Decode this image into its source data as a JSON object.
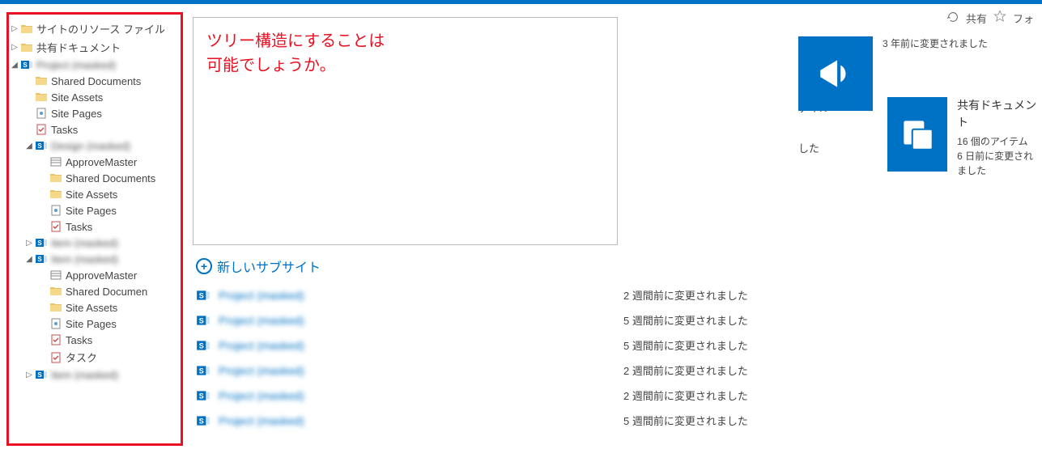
{
  "header": {
    "share_label": "共有",
    "follow_label": "フォ"
  },
  "annotation": {
    "line1": "ツリー構造にすることは",
    "line2": "可能でしょうか。"
  },
  "sidebar": {
    "items": [
      {
        "label": "サイトのリソース ファイル",
        "icon": "folder-icon",
        "expander": "▷",
        "indent": 0
      },
      {
        "label": "共有ドキュメント",
        "icon": "folder-icon",
        "expander": "▷",
        "indent": 0
      },
      {
        "label": "Project (masked)",
        "icon": "sharepoint-icon",
        "expander": "◢",
        "indent": 0,
        "masked": true
      },
      {
        "label": "Shared Documents",
        "icon": "folder-icon",
        "expander": "",
        "indent": 1
      },
      {
        "label": "Site Assets",
        "icon": "folder-icon",
        "expander": "",
        "indent": 1
      },
      {
        "label": "Site Pages",
        "icon": "page-icon",
        "expander": "",
        "indent": 1
      },
      {
        "label": "Tasks",
        "icon": "task-icon",
        "expander": "",
        "indent": 1
      },
      {
        "label": "Design (masked)",
        "icon": "sharepoint-icon",
        "expander": "◢",
        "indent": 1,
        "masked": true
      },
      {
        "label": "ApproveMaster",
        "icon": "list-icon",
        "expander": "",
        "indent": 2
      },
      {
        "label": "Shared Documents",
        "icon": "folder-icon",
        "expander": "",
        "indent": 2
      },
      {
        "label": "Site Assets",
        "icon": "folder-icon",
        "expander": "",
        "indent": 2
      },
      {
        "label": "Site Pages",
        "icon": "page-icon",
        "expander": "",
        "indent": 2
      },
      {
        "label": "Tasks",
        "icon": "task-icon",
        "expander": "",
        "indent": 2
      },
      {
        "label": "Item (masked)",
        "icon": "sharepoint-icon",
        "expander": "▷",
        "indent": 1,
        "masked": true
      },
      {
        "label": "Item (masked)",
        "icon": "sharepoint-icon",
        "expander": "◢",
        "indent": 1,
        "masked": true
      },
      {
        "label": "ApproveMaster",
        "icon": "list-icon",
        "expander": "",
        "indent": 2
      },
      {
        "label": "Shared Documen",
        "icon": "folder-icon",
        "expander": "",
        "indent": 2
      },
      {
        "label": "Site Assets",
        "icon": "folder-icon",
        "expander": "",
        "indent": 2
      },
      {
        "label": "Site Pages",
        "icon": "page-icon",
        "expander": "",
        "indent": 2
      },
      {
        "label": "Tasks",
        "icon": "task-icon",
        "expander": "",
        "indent": 2
      },
      {
        "label": "タスク",
        "icon": "task-icon",
        "expander": "",
        "indent": 2
      },
      {
        "label": "Item (masked)",
        "icon": "sharepoint-icon",
        "expander": "▷",
        "indent": 1,
        "masked": true
      }
    ]
  },
  "partial": {
    "p1": "ました",
    "p2": "ァイル",
    "p3": "した"
  },
  "tiles": {
    "t1_meta": "3 年前に変更されました",
    "t2_title": "共有ドキュメント",
    "t2_meta1": "16 個のアイテム",
    "t2_meta2": "6 日前に変更されました"
  },
  "new_subsite_label": "新しいサブサイト",
  "subsites": [
    {
      "name": "Project (masked)",
      "date": "2 週間前に変更されました"
    },
    {
      "name": "Project (masked)",
      "date": "5 週間前に変更されました"
    },
    {
      "name": "Project (masked)",
      "date": "5 週間前に変更されました"
    },
    {
      "name": "Project (masked)",
      "date": "2 週間前に変更されました"
    },
    {
      "name": "Project (masked)",
      "date": "2 週間前に変更されました"
    },
    {
      "name": "Project (masked)",
      "date": "5 週間前に変更されました"
    }
  ]
}
